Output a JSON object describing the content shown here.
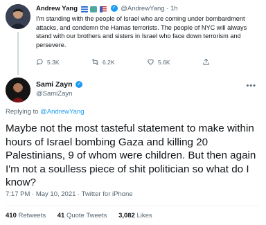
{
  "tweet1": {
    "name": "Andrew Yang",
    "emojis": [
      "flag-greece-icon",
      "statue-of-liberty-icon",
      "flag-us-icon"
    ],
    "handle": "@AndrewYang",
    "separator": "·",
    "time": "1h",
    "text": "I'm standing with the people of Israel who are coming under bombardment attacks, and condemn the Hamas terrorists. The people of NYC will always stand with our brothers and sisters in Israel who face down terrorism and persevere.",
    "replies": "5.3K",
    "retweets": "6.2K",
    "likes": "5.6K"
  },
  "tweet2": {
    "name": "Sami Zayn",
    "handle": "@SamiZayn",
    "replying_prefix": "Replying to",
    "replying_to": "@AndrewYang",
    "text": "Maybe not the most tasteful statement to make within hours of Israel bombing Gaza and killing 20 Palestinians, 9 of whom were children. But then again I'm not a soulless piece of shit politician so what do I know?",
    "time": "7:17 PM · May 10, 2021",
    "separator": "·",
    "app": "Twitter for iPhone",
    "retweets_count": "410",
    "retweets_label": "Retweets",
    "quotes_count": "41",
    "quotes_label": "Quote Tweets",
    "likes_count": "3,082",
    "likes_label": "Likes"
  },
  "colors": {
    "accent": "#1d9bf0",
    "text": "#0f1419",
    "muted": "#536471"
  }
}
